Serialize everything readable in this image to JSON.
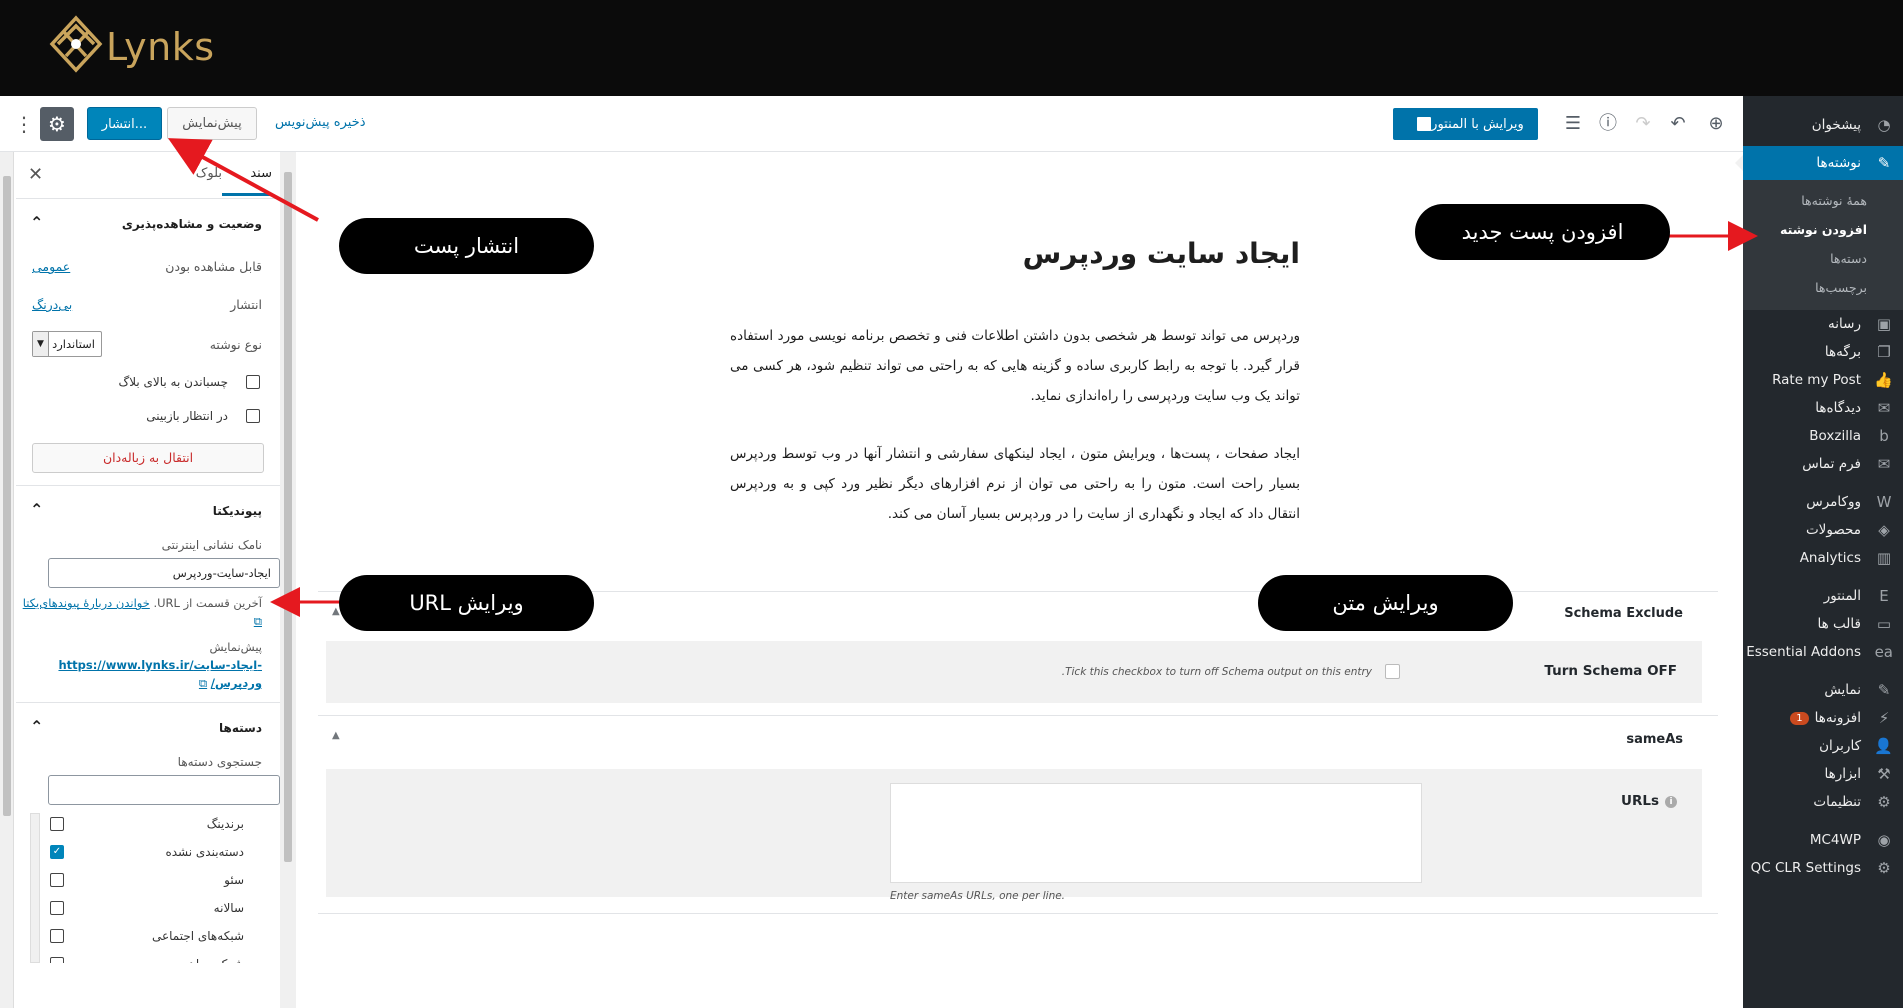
{
  "brand": {
    "name": "Lynks",
    "logo_icon": "lynks-diamond-logo",
    "gold": "#c9a45c"
  },
  "colors": {
    "wp_blue": "#0073aa",
    "admin_dark": "#23282d",
    "annotation_red": "#e5191f",
    "pill_black": "#000000"
  },
  "admin_menu": {
    "dashboard": "پیشخوان",
    "posts": "نوشته‌ها",
    "posts_sub": [
      "همهٔ نوشته‌ها",
      "افزودن نوشته",
      "دسته‌ها",
      "برچسب‌ها"
    ],
    "items_a": [
      {
        "label": "رسانه",
        "icon": "media-icon"
      },
      {
        "label": "برگه‌ها",
        "icon": "pages-icon"
      },
      {
        "label": "Rate my Post",
        "icon": "thumbs-up-icon"
      },
      {
        "label": "دیدگاه‌ها",
        "icon": "comments-icon"
      },
      {
        "label": "Boxzilla",
        "icon": "boxzilla-icon"
      },
      {
        "label": "فرم تماس",
        "icon": "mail-icon"
      }
    ],
    "items_b": [
      {
        "label": "ووکامرس",
        "icon": "woo-icon"
      },
      {
        "label": "محصولات",
        "icon": "products-icon"
      },
      {
        "label": "Analytics",
        "icon": "analytics-icon"
      }
    ],
    "items_c": [
      {
        "label": "المنتور",
        "icon": "elementor-icon"
      },
      {
        "label": "قالب ها",
        "icon": "templates-icon"
      },
      {
        "label": "Essential Addons",
        "icon": "ea-icon"
      }
    ],
    "items_d": [
      {
        "label": "نمایش",
        "icon": "appearance-icon"
      },
      {
        "label": "افزونه‌ها",
        "icon": "plugins-icon",
        "badge": "1"
      },
      {
        "label": "کاربران",
        "icon": "users-icon"
      },
      {
        "label": "ابزارها",
        "icon": "tools-icon"
      },
      {
        "label": "تنظیمات",
        "icon": "settings-icon"
      }
    ],
    "items_e": [
      {
        "label": "MC4WP",
        "icon": "mc4wp-icon"
      },
      {
        "label": "QC CLR Settings",
        "icon": "gear-icon"
      }
    ]
  },
  "toolbar": {
    "elementor_label": "ویرایش با المنتور",
    "publish_label": "انتشار...",
    "preview_label": "پیش‌نمایش",
    "save_draft_label": "ذخیره پیش‌نویس"
  },
  "settings": {
    "tab_document": "سند",
    "tab_block": "بلوک",
    "status_title": "وضعیت و مشاهده‌پذیری",
    "visibility_label": "قابل مشاهده بودن",
    "visibility_value": "عمومی",
    "publish_label": "انتشار",
    "publish_value": "بی‌درنگ",
    "format_label": "نوع نوشته",
    "format_value": "استاندارد",
    "sticky_label": "چسباندن به بالای بلاگ",
    "pending_label": "در انتظار بازبینی",
    "trash_label": "انتقال به زباله‌دان",
    "permalink_title": "پیوندیکتا",
    "slug_label": "نامک نشانی اینترنتی",
    "slug_value": "ایجاد-سایت-وردپرس",
    "slug_help_1": "آخرین قسمت از URL.",
    "slug_help_link": "خواندن دربارهٔ پیوندهای‌یکتا",
    "preview_title": "پیش‌نمایش",
    "preview_url_1": "https://www.lynks.ir/ایجاد-سایت-",
    "preview_url_2": "وردپرس/",
    "categories_title": "دسته‌ها",
    "cat_search_label": "جستجوی دسته‌ها",
    "categories": [
      {
        "label": "برندینگ",
        "checked": false
      },
      {
        "label": "دسته‌بندی نشده",
        "checked": true
      },
      {
        "label": "سئو",
        "checked": false
      },
      {
        "label": "سالانه",
        "checked": false
      },
      {
        "label": "شبکه‌های اجتماعی",
        "checked": false
      },
      {
        "label": "شرکت ماهر",
        "checked": false
      }
    ]
  },
  "post": {
    "title": "ایجاد سایت وردپرس",
    "paragraph_1": "وردپرس می تواند توسط هر شخصی بدون داشتن اطلاعات فنی و تخصص برنامه  نویسی مورد استفاده قرار گیرد. با توجه به رابط کاربری ساده و گزینه هایی  که به  راحتی می تواند تنظیم شود، هر کسی می تواند یک وب سایت وردپرسی را  راه‌اندازی نماید.",
    "paragraph_2": "ایجاد صفحات ، پست‌ها ، ویرایش متون ، ایجاد لینکهای سفارشی و انتشار  آنها در وب توسط وردپرس بسیار راحت است. متون را به راحتی می توان از نرم  افزارهای دیگر نظیر ورد کپی و به وردپرس انتقال داد که ایجاد و نگهداری از  سایت را در وردپرس بسیار آسان می کند."
  },
  "schema": {
    "exclude_title": "Schema Exclude",
    "turn_off_label": "Turn Schema OFF",
    "turn_off_desc": "Tick this checkbox to turn off Schema output on this entry.",
    "sameas_title": "sameAs",
    "urls_label": "URLs",
    "urls_desc": "Enter sameAs URLs, one per line."
  },
  "annotations": {
    "publish_post": "انتشار پست",
    "add_new_post": "افزودن پست جدید",
    "edit_url": "ویرایش URL",
    "edit_text": "ویرایش متن"
  }
}
